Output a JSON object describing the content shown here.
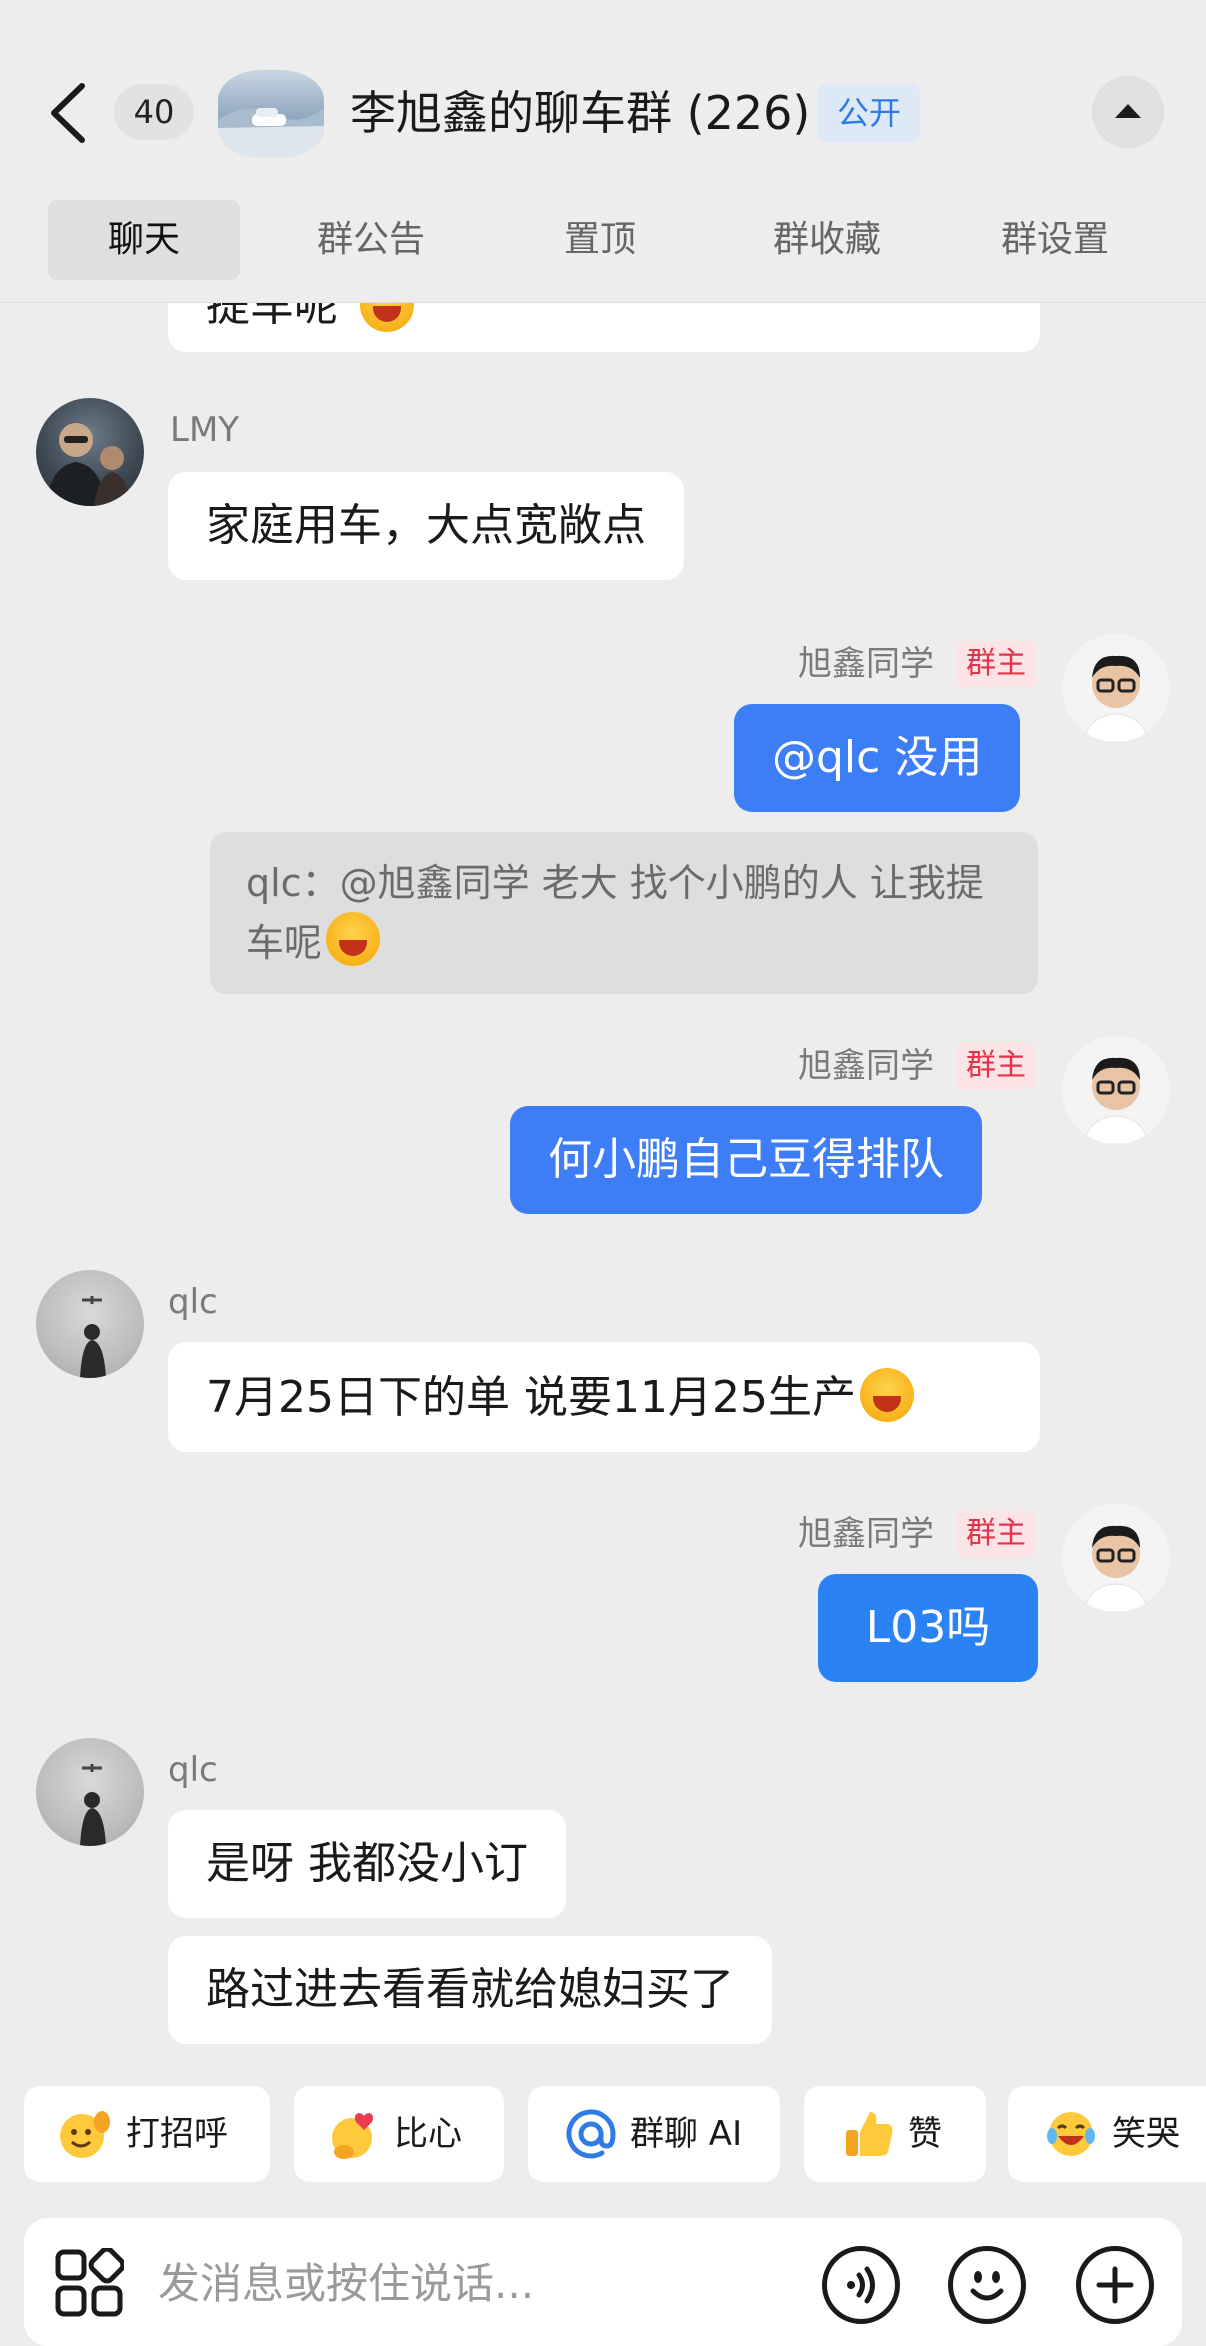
{
  "header": {
    "back_icon": "chevron-left-icon",
    "unread_count": "40",
    "group_title": "李旭鑫的聊车群 (226)",
    "public_badge": "公开",
    "collapse_icon": "triangle-up-icon",
    "tabs": [
      {
        "label": "聊天",
        "active": true
      },
      {
        "label": "群公告",
        "active": false
      },
      {
        "label": "置顶",
        "active": false
      },
      {
        "label": "群收藏",
        "active": false
      },
      {
        "label": "群设置",
        "active": false
      }
    ]
  },
  "messages": {
    "partial_top": {
      "text": "提车呢"
    },
    "m1": {
      "sender": "LMY",
      "text": "家庭用车，大点宽敞点"
    },
    "m2": {
      "sender": "旭鑫同学",
      "tag": "群主",
      "text": "@qlc 没用",
      "quote": "qlc：@旭鑫同学 老大 找个小鹏的人 让我提车呢"
    },
    "m3": {
      "sender": "旭鑫同学",
      "tag": "群主",
      "text": "何小鹏自己豆得排队"
    },
    "m4": {
      "sender": "qlc",
      "text": "7月25日下的单 说要11月25生产"
    },
    "m5": {
      "sender": "旭鑫同学",
      "tag": "群主",
      "text": "L03吗"
    },
    "m6": {
      "sender": "qlc",
      "text": "是呀 我都没小订"
    },
    "m7": {
      "text": "路过进去看看就给媳妇买了"
    }
  },
  "quick_replies": [
    {
      "label": "打招呼",
      "icon": "waving-face-icon"
    },
    {
      "label": "比心",
      "icon": "heart-hands-icon"
    },
    {
      "label": "群聊 AI",
      "icon": "at-sign-icon"
    },
    {
      "label": "赞",
      "icon": "thumbs-up-icon"
    },
    {
      "label": "笑哭",
      "icon": "laughing-crying-icon"
    }
  ],
  "input": {
    "placeholder": "发消息或按住说话...",
    "value": ""
  },
  "colors": {
    "background": "#ededed",
    "outgoing_bubble": "#3d7ef7",
    "incoming_bubble": "#ffffff",
    "owner_tag_text": "#e2334a",
    "public_badge_text": "#2f7be5"
  }
}
